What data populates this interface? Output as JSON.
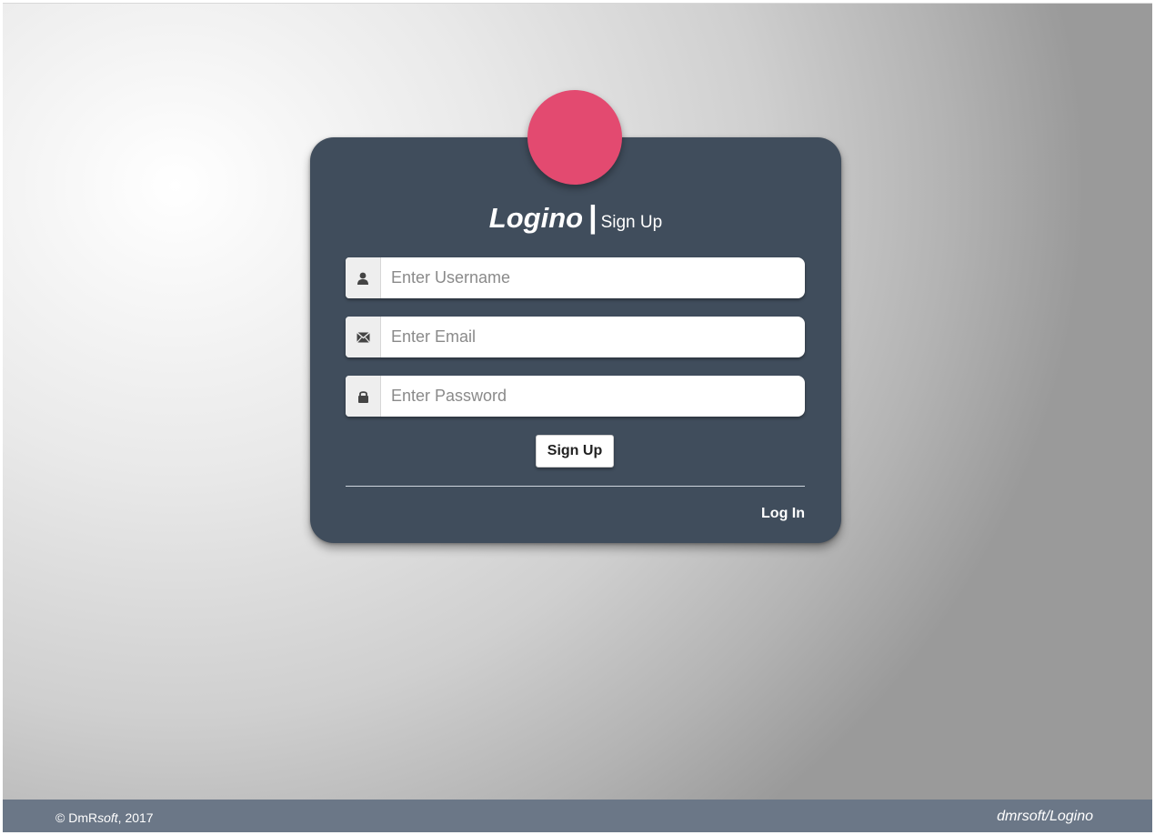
{
  "brand": {
    "name": "Logino",
    "separator": "|",
    "subtitle": "Sign Up",
    "avatar_color": "#e34a70"
  },
  "form": {
    "username": {
      "placeholder": "Enter Username",
      "value": "",
      "icon": "user-icon"
    },
    "email": {
      "placeholder": "Enter Email",
      "value": "",
      "icon": "envelope-icon"
    },
    "password": {
      "placeholder": "Enter Password",
      "value": "",
      "icon": "lock-icon"
    },
    "submit_label": "Sign Up",
    "alt_link_label": "Log In"
  },
  "footer": {
    "copyright_prefix": "© DmR",
    "copyright_soft": "soft",
    "copyright_suffix": ", 2017",
    "repo": "dmrsoft/Logino"
  },
  "colors": {
    "card": "#404d5c",
    "footer": "#6b7787",
    "accent": "#e34a70"
  }
}
